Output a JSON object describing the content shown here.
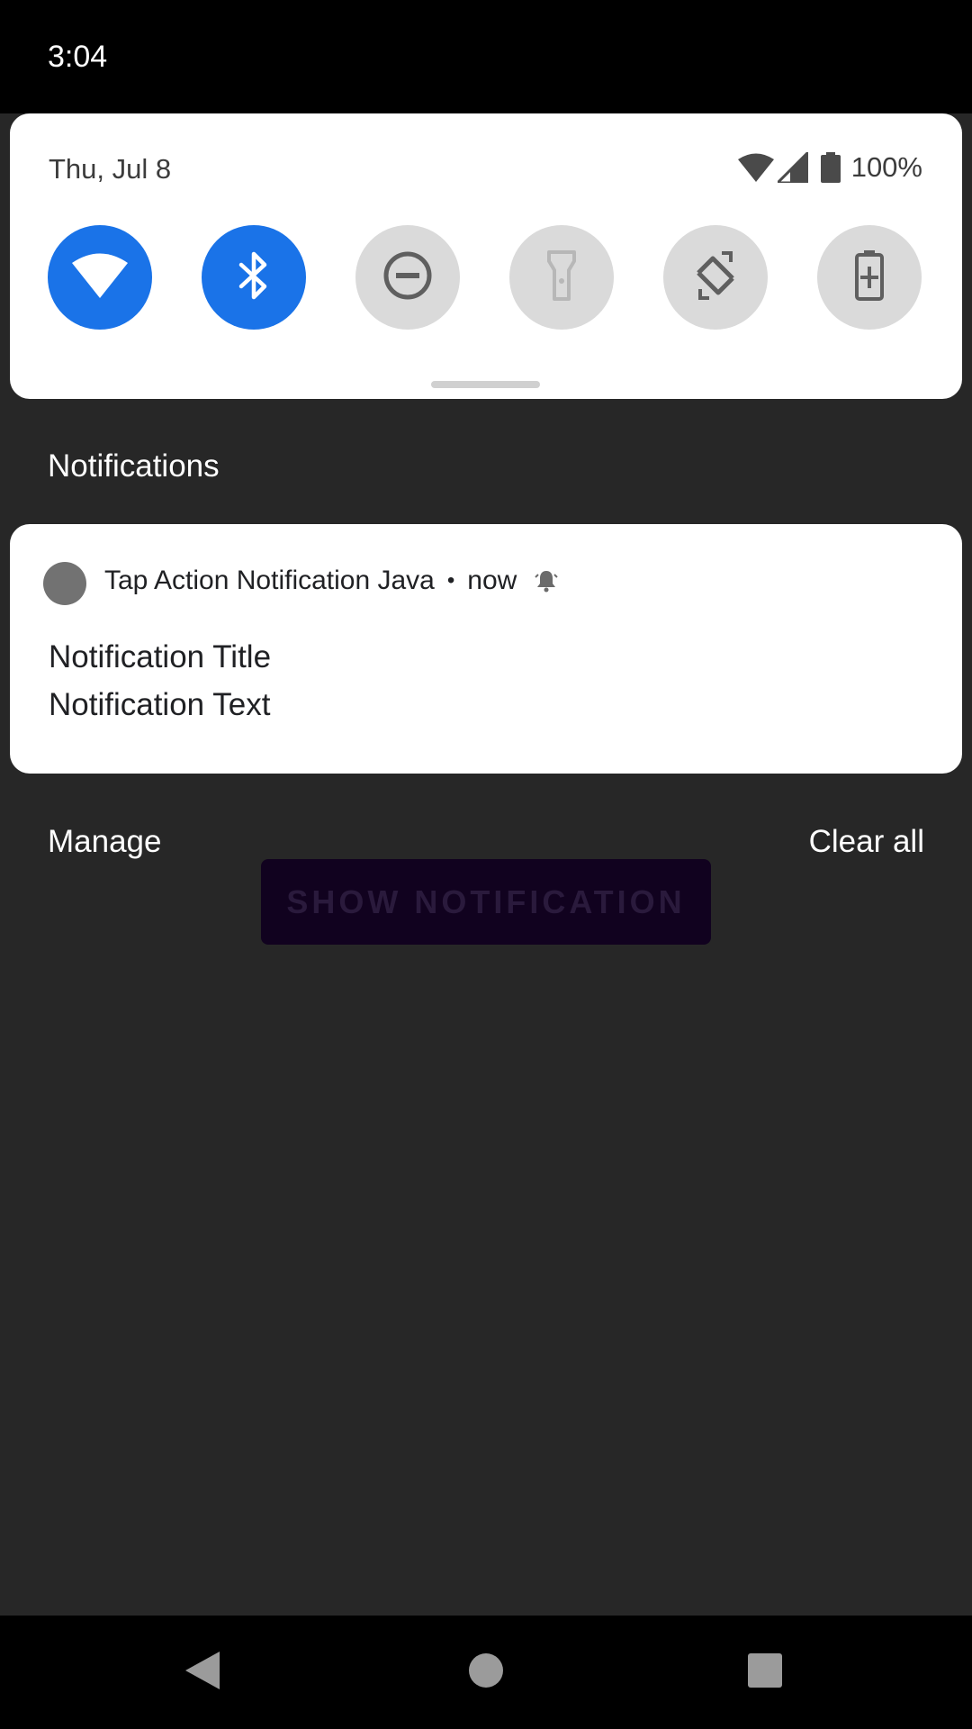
{
  "status_bar": {
    "time": "3:04"
  },
  "quick_settings": {
    "date": "Thu, Jul 8",
    "battery_percent": "100%",
    "tiles": [
      {
        "name": "wifi",
        "icon": "wifi-icon",
        "state": "on"
      },
      {
        "name": "bluetooth",
        "icon": "bluetooth-icon",
        "state": "on"
      },
      {
        "name": "do-not-disturb",
        "icon": "dnd-icon",
        "state": "off"
      },
      {
        "name": "flashlight",
        "icon": "flashlight-icon",
        "state": "unavailable"
      },
      {
        "name": "auto-rotate",
        "icon": "rotate-icon",
        "state": "off"
      },
      {
        "name": "battery-saver",
        "icon": "battery-saver-icon",
        "state": "off"
      }
    ],
    "colors": {
      "tile_on": "#1a73e8",
      "tile_off": "#dadada"
    }
  },
  "notifications": {
    "header": "Notifications",
    "items": [
      {
        "app_name": "Tap Action Notification Java",
        "separator": "•",
        "time": "now",
        "title": "Notification Title",
        "text": "Notification Text"
      }
    ],
    "manage_label": "Manage",
    "clear_all_label": "Clear all"
  },
  "background_app": {
    "button_label": "SHOW NOTIFICATION"
  }
}
